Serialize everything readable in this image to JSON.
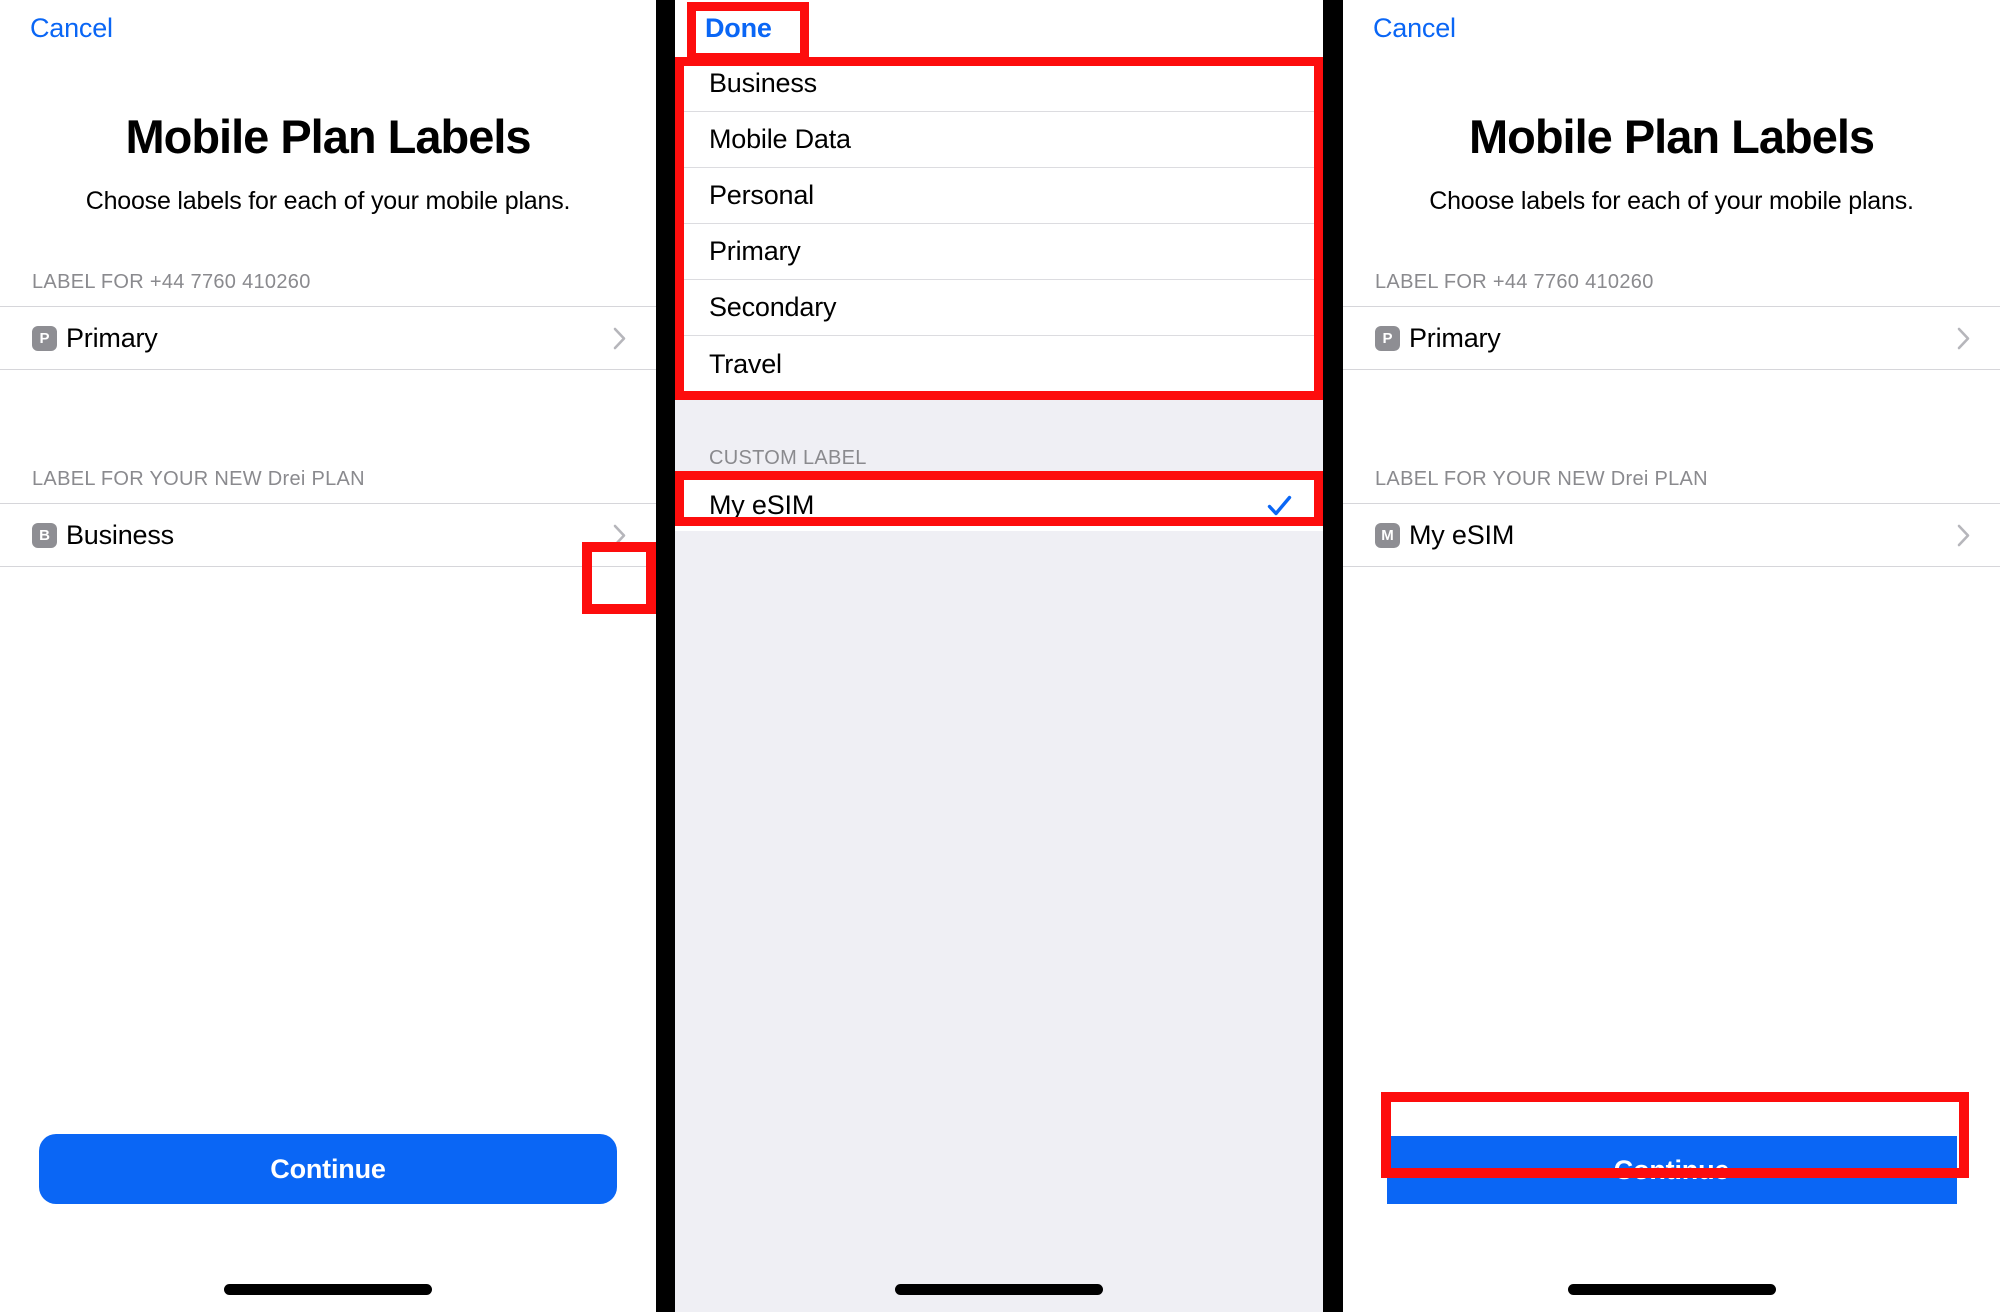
{
  "panels": [
    {
      "id": "panel-initial",
      "nav": {
        "action_label": "Cancel"
      },
      "title": "Mobile Plan Labels",
      "subtitle": "Choose labels for each of your mobile plans.",
      "sections": [
        {
          "header": "LABEL FOR +44 7760 410260",
          "row": {
            "badge": "P",
            "label": "Primary",
            "chevron": "chevron-right-icon"
          }
        },
        {
          "header": "LABEL FOR YOUR NEW Drei PLAN",
          "row": {
            "badge": "B",
            "label": "Business",
            "chevron": "chevron-right-icon"
          }
        }
      ],
      "cta_label": "Continue"
    },
    {
      "id": "panel-label-picker",
      "nav": {
        "action_label": "Done"
      },
      "options": [
        "Business",
        "Mobile Data",
        "Personal",
        "Primary",
        "Secondary",
        "Travel"
      ],
      "custom_section_header": "CUSTOM LABEL",
      "custom_option": {
        "label": "My eSIM",
        "selected": true,
        "check_icon": "checkmark-icon"
      }
    },
    {
      "id": "panel-result",
      "nav": {
        "action_label": "Cancel"
      },
      "title": "Mobile Plan Labels",
      "subtitle": "Choose labels for each of your mobile plans.",
      "sections": [
        {
          "header": "LABEL FOR +44 7760 410260",
          "row": {
            "badge": "P",
            "label": "Primary",
            "chevron": "chevron-right-icon"
          }
        },
        {
          "header": "LABEL FOR YOUR NEW Drei PLAN",
          "row": {
            "badge": "M",
            "label": "My eSIM",
            "chevron": "chevron-right-icon"
          }
        }
      ],
      "cta_label": "Continue"
    }
  ],
  "colors": {
    "accent_blue": "#0a66f5",
    "annotation_red": "#fd0d0d",
    "badge_gray": "#8e8e93",
    "section_header_gray": "#8a8a8e",
    "picker_background": "#efeff4"
  }
}
